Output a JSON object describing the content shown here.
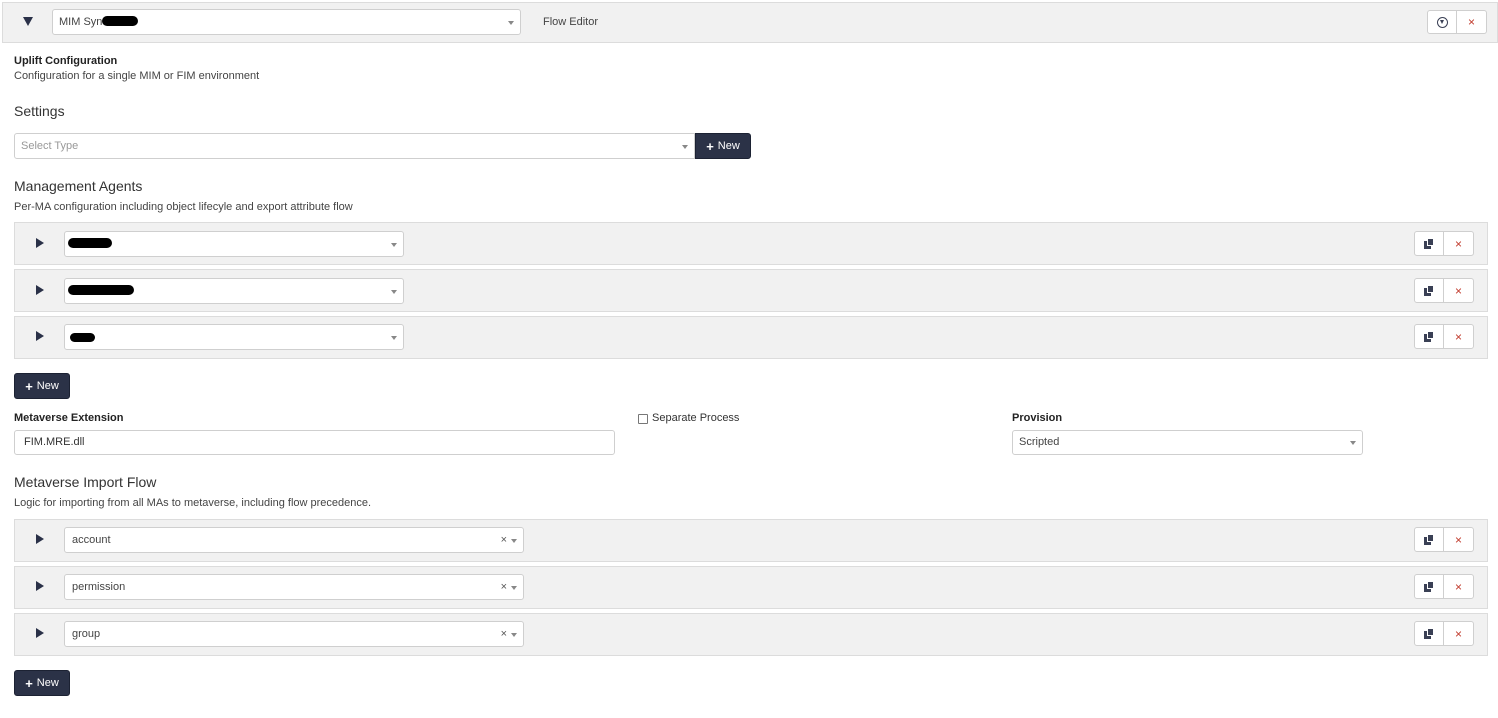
{
  "topbar": {
    "environment_value": "MIM Sync",
    "flow_editor_label": "Flow Editor",
    "close_glyph": "×"
  },
  "uplift": {
    "title": "Uplift Configuration",
    "description": "Configuration for a single MIM or FIM environment"
  },
  "settings": {
    "heading": "Settings",
    "select_placeholder": "Select Type",
    "new_label": "New"
  },
  "management_agents": {
    "heading": "Management Agents",
    "description": "Per-MA configuration including object lifecyle and export attribute flow",
    "new_label": "New",
    "rows": [
      {
        "value": "",
        "redacted": true
      },
      {
        "value": "",
        "redacted": true
      },
      {
        "value": "",
        "redacted": true
      }
    ]
  },
  "metaverse_extension": {
    "label": "Metaverse Extension",
    "value": "FIM.MRE.dll",
    "separate_process_label": "Separate Process",
    "separate_process_checked": false,
    "provision_label": "Provision",
    "provision_value": "Scripted"
  },
  "import_flow": {
    "heading": "Metaverse Import Flow",
    "description": "Logic for importing from all MAs to metaverse, including flow precedence.",
    "new_label": "New",
    "rows": [
      {
        "value": "account"
      },
      {
        "value": "permission"
      },
      {
        "value": "group"
      }
    ]
  },
  "icons": {
    "expand": "caret-right-icon",
    "collapse": "caret-down-icon",
    "copy": "copy-icon",
    "delete": "close-icon",
    "download": "download-icon",
    "add": "plus-icon"
  },
  "colors": {
    "primary_button": "#2b3247",
    "panel_bg": "#f1f1f1",
    "delete_red": "#c0392b"
  }
}
